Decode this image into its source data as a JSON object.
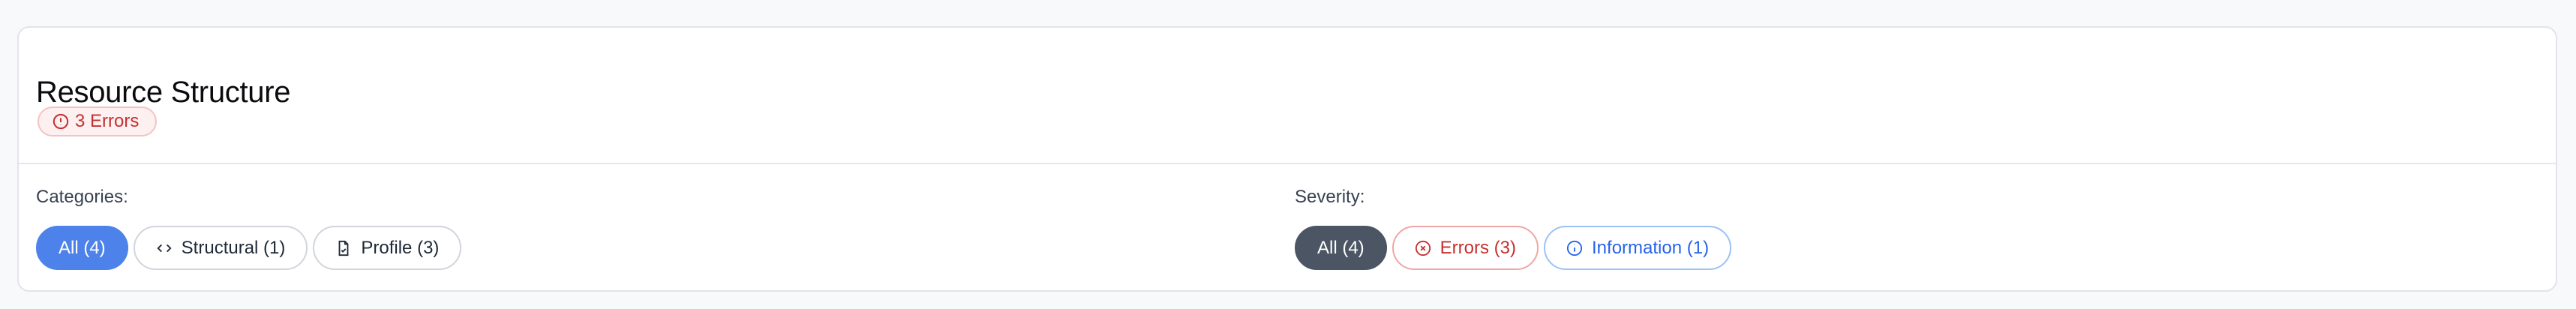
{
  "header": {
    "title": "Resource Structure",
    "error_badge": "3 Errors"
  },
  "categories": {
    "label": "Categories:",
    "items": [
      {
        "label": "All (4)",
        "icon": null,
        "active": true
      },
      {
        "label": "Structural (1)",
        "icon": "code-icon",
        "active": false
      },
      {
        "label": "Profile (3)",
        "icon": "file-check-icon",
        "active": false
      }
    ]
  },
  "severity": {
    "label": "Severity:",
    "items": [
      {
        "label": "All (4)",
        "active": true
      },
      {
        "label": "Errors (3)",
        "icon": "x-circle-icon",
        "color": "#c53030"
      },
      {
        "label": "Information (1)",
        "icon": "info-circle-icon",
        "color": "#2563eb"
      }
    ]
  },
  "colors": {
    "accent": "#4d82ea",
    "error": "#c53030",
    "info": "#2563eb",
    "dark": "#4b5563"
  }
}
